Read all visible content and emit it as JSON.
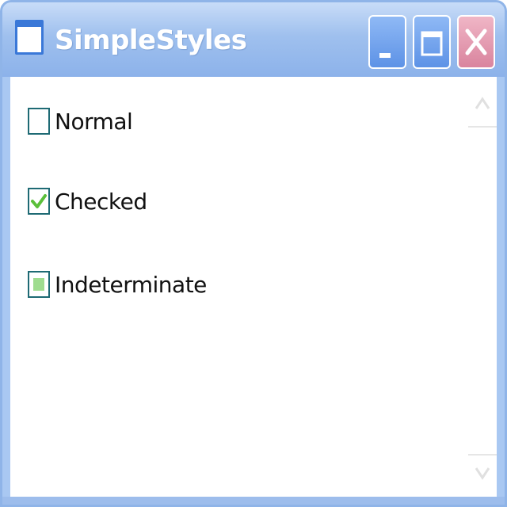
{
  "window": {
    "title": "SimpleStyles",
    "icon": "window-app-icon",
    "controls": [
      "minimize-icon",
      "maximize-icon",
      "close-icon"
    ]
  },
  "checkboxes": [
    {
      "label": "Normal",
      "state": "unchecked"
    },
    {
      "label": "Checked",
      "state": "checked"
    },
    {
      "label": "Indeterminate",
      "state": "indeterminate"
    }
  ],
  "scrollbar": {
    "up_icon": "chevron-up-icon",
    "down_icon": "chevron-down-icon"
  },
  "colors": {
    "titlebar": "#9fc0ee",
    "checkbox_border": "#1e6a74",
    "check_mark": "#5bbf3a",
    "indeterminate_fill": "#9fdc8f",
    "close_button": "#d9849e"
  }
}
